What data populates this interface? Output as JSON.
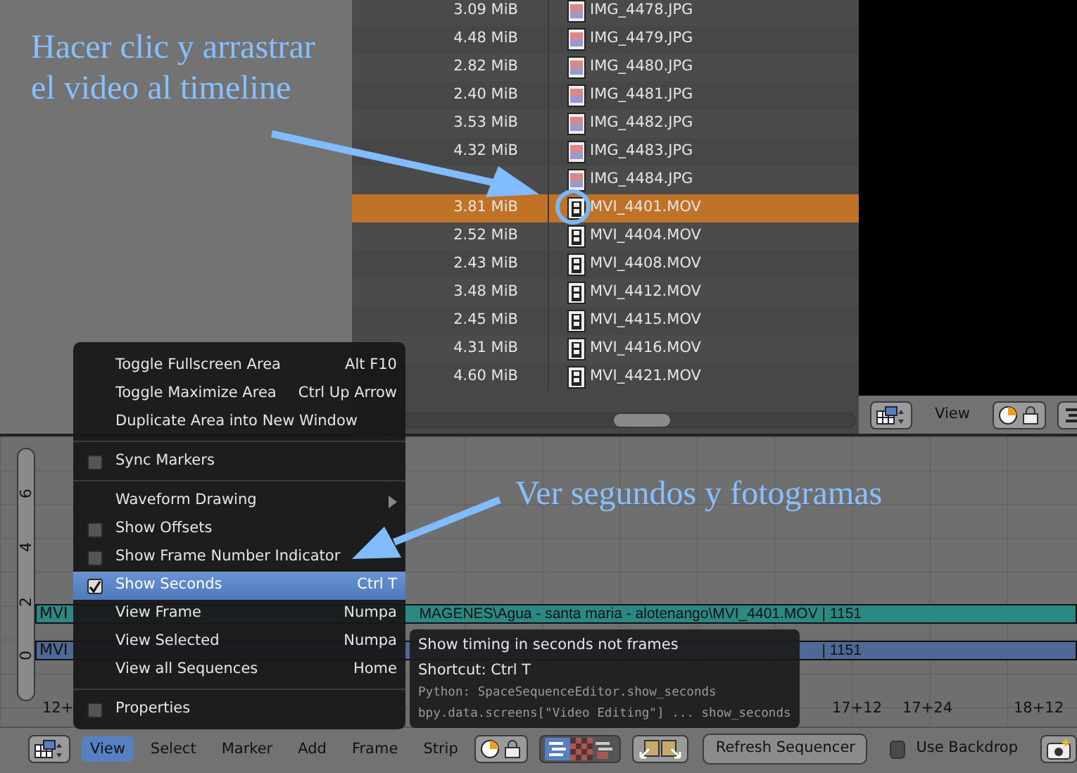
{
  "file_browser": {
    "files": [
      {
        "size": "3.09 MiB",
        "name": "IMG_4478.JPG",
        "kind": "image",
        "selected": false
      },
      {
        "size": "4.48 MiB",
        "name": "IMG_4479.JPG",
        "kind": "image",
        "selected": false
      },
      {
        "size": "2.82 MiB",
        "name": "IMG_4480.JPG",
        "kind": "image",
        "selected": false
      },
      {
        "size": "2.40 MiB",
        "name": "IMG_4481.JPG",
        "kind": "image",
        "selected": false
      },
      {
        "size": "3.53 MiB",
        "name": "IMG_4482.JPG",
        "kind": "image",
        "selected": false
      },
      {
        "size": "4.32 MiB",
        "name": "IMG_4483.JPG",
        "kind": "image",
        "selected": false
      },
      {
        "name": "IMG_4484.JPG",
        "kind": "image",
        "selected": false
      },
      {
        "size": "3.81 MiB",
        "name": "MVI_4401.MOV",
        "kind": "movie",
        "selected": true
      },
      {
        "size": "2.52 MiB",
        "name": "MVI_4404.MOV",
        "kind": "movie",
        "selected": false
      },
      {
        "size": "2.43 MiB",
        "name": "MVI_4408.MOV",
        "kind": "movie",
        "selected": false
      },
      {
        "size": "3.48 MiB",
        "name": "MVI_4412.MOV",
        "kind": "movie",
        "selected": false
      },
      {
        "size": "2.45 MiB",
        "name": "MVI_4415.MOV",
        "kind": "movie",
        "selected": false
      },
      {
        "size": "4.31 MiB",
        "name": "MVI_4416.MOV",
        "kind": "movie",
        "selected": false
      },
      {
        "size": "4.60 MiB",
        "name": "MVI_4421.MOV",
        "kind": "movie",
        "selected": false
      }
    ]
  },
  "preview_header": {
    "menu": "View"
  },
  "annotations": [
    {
      "text": "Hacer clic y arrastrar el video al timeline"
    },
    {
      "text": "Ver segundos y fotogramas"
    }
  ],
  "sequencer": {
    "channels": [
      "6",
      "4",
      "2",
      "0"
    ],
    "strips": [
      {
        "left_text": "MVI",
        "right_text": "MAGENES\\Agua - santa maria - alotenango\\MVI_4401.MOV | 1151",
        "color": "#2a8a83"
      },
      {
        "left_text": "MVI",
        "right_text": "| 1151",
        "color": "#4e6995"
      }
    ],
    "time_ticks": [
      {
        "label": "12+"
      },
      {
        "label": "17+12"
      },
      {
        "label": "17+24"
      },
      {
        "label": "18+12"
      }
    ]
  },
  "view_menu": {
    "items": [
      {
        "kind": "action",
        "label": "Toggle Fullscreen Area",
        "shortcut": "Alt F10"
      },
      {
        "kind": "action",
        "label": "Toggle Maximize Area",
        "shortcut": "Ctrl Up Arrow"
      },
      {
        "kind": "action",
        "label": "Duplicate Area into New Window"
      },
      {
        "kind": "separator"
      },
      {
        "kind": "toggle",
        "label": "Sync Markers",
        "checked": false,
        "selected": false
      },
      {
        "kind": "separator"
      },
      {
        "kind": "submenu",
        "label": "Waveform Drawing"
      },
      {
        "kind": "toggle",
        "label": "Show Offsets",
        "checked": false,
        "selected": false
      },
      {
        "kind": "toggle",
        "label": "Show Frame Number Indicator",
        "checked": false,
        "selected": false
      },
      {
        "kind": "toggle",
        "label": "Show Seconds",
        "checked": true,
        "selected": true,
        "shortcut": "Ctrl T"
      },
      {
        "kind": "action",
        "label": "View Frame",
        "shortcut": "Numpa"
      },
      {
        "kind": "action",
        "label": "View Selected",
        "shortcut": "Numpa"
      },
      {
        "kind": "action",
        "label": "View all Sequences",
        "shortcut": "Home"
      },
      {
        "kind": "separator"
      },
      {
        "kind": "toggle",
        "label": "Properties",
        "checked": false,
        "selected": false
      }
    ]
  },
  "tooltip": {
    "lines": [
      {
        "kind": "title",
        "text": "Show timing in seconds not frames"
      },
      {
        "kind": "shortcut",
        "text": "Shortcut: Ctrl T"
      },
      {
        "kind": "python",
        "text": "Python: SpaceSequenceEditor.show_seconds"
      },
      {
        "kind": "python",
        "text": "bpy.data.screens[\"Video Editing\"] ... show_seconds"
      }
    ]
  },
  "header": {
    "menus": [
      {
        "label": "View",
        "selected": true
      },
      {
        "label": "Select",
        "selected": false
      },
      {
        "label": "Marker",
        "selected": false
      },
      {
        "label": "Add",
        "selected": false
      },
      {
        "label": "Frame",
        "selected": false
      },
      {
        "label": "Strip",
        "selected": false
      }
    ],
    "refresh_button": "Refresh Sequencer",
    "use_backdrop": {
      "label": "Use Backdrop",
      "checked": false
    }
  }
}
